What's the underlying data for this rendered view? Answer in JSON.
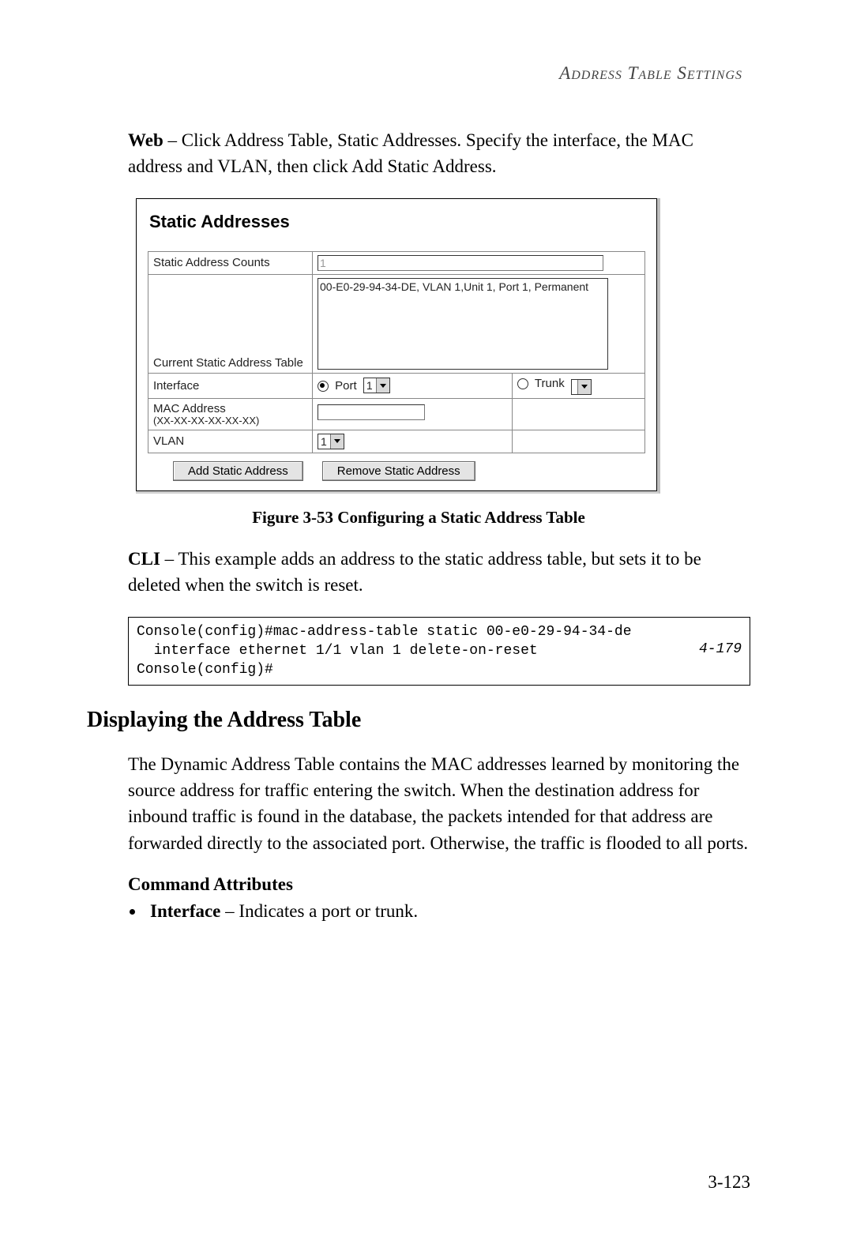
{
  "header": {
    "title": "Address Table Settings"
  },
  "web_instruction": {
    "lead": "Web",
    "dash": " – ",
    "text": "Click Address Table, Static Addresses. Specify the interface, the MAC address and VLAN, then click Add Static Address."
  },
  "screenshot": {
    "title": "Static Addresses",
    "rows": {
      "count_label": "Static Address Counts",
      "count_value": "1",
      "current_label": "Current Static Address Table",
      "list_entry": "00-E0-29-94-34-DE, VLAN 1,Unit 1, Port 1, Permanent",
      "interface_label": "Interface",
      "port_radio_label": "Port",
      "port_value": "1",
      "trunk_radio_label": "Trunk",
      "trunk_value": "",
      "mac_label": "MAC Address",
      "mac_hint": "(XX-XX-XX-XX-XX-XX)",
      "vlan_label": "VLAN",
      "vlan_value": "1"
    },
    "buttons": {
      "add": "Add Static Address",
      "remove": "Remove Static Address"
    }
  },
  "figure_caption": "Figure 3-53  Configuring a Static Address Table",
  "cli_instruction": {
    "lead": "CLI",
    "dash": " – ",
    "text": "This example adds an address to the static address table, but sets it to be deleted when the switch is reset."
  },
  "cli_box": {
    "line1": "Console(config)#mac-address-table static 00-e0-29-94-34-de",
    "line2": "  interface ethernet 1/1 vlan 1 delete-on-reset",
    "line3": "Console(config)#",
    "ref": "4-179"
  },
  "section_heading": "Displaying the Address Table",
  "section_body": "The Dynamic Address Table contains the MAC addresses learned by monitoring the source address for traffic entering the switch. When the destination address for inbound traffic is found in the database, the packets intended for that address are forwarded directly to the associated port. Otherwise, the traffic is flooded to all ports.",
  "cmd_attrs_heading": "Command Attributes",
  "cmd_attrs": {
    "interface": {
      "term": "Interface",
      "dash": " – ",
      "desc": "Indicates a port or trunk."
    }
  },
  "page_number": "3-123"
}
